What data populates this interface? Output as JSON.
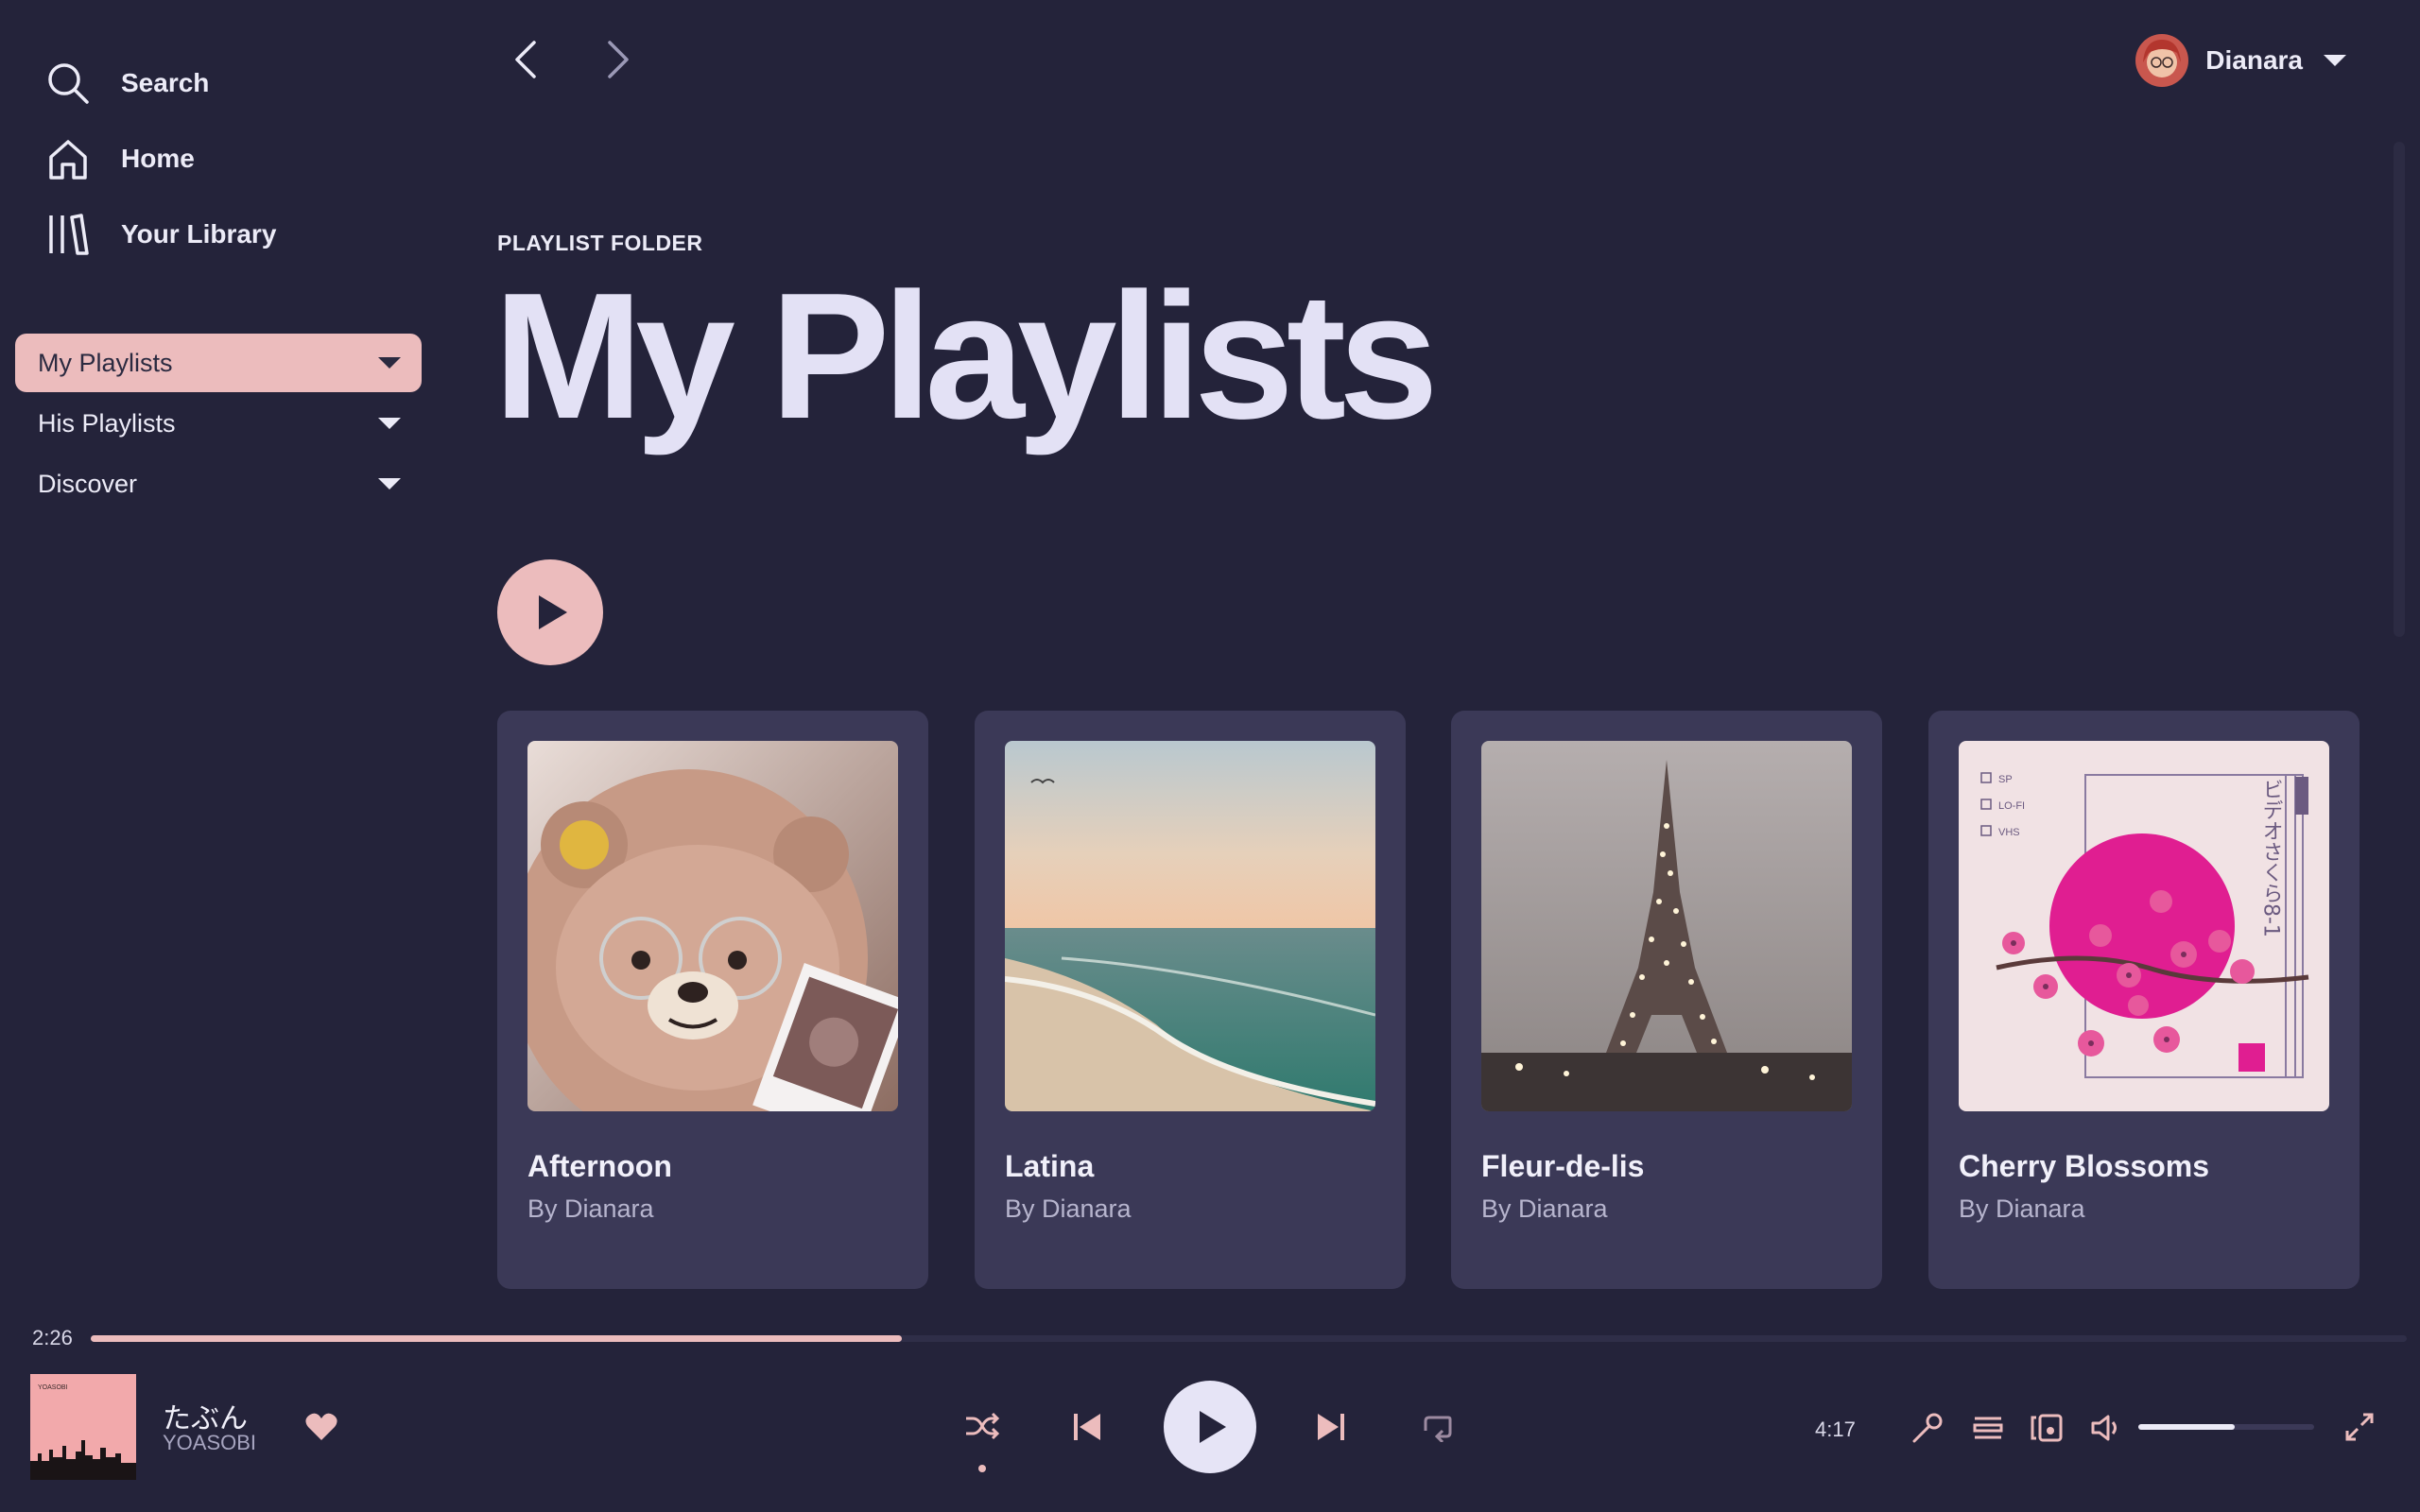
{
  "sidebar": {
    "nav": [
      {
        "label": "Search",
        "icon": "search-icon"
      },
      {
        "label": "Home",
        "icon": "home-icon"
      },
      {
        "label": "Your Library",
        "icon": "library-icon"
      }
    ],
    "folders": [
      {
        "label": "My Playlists",
        "active": true
      },
      {
        "label": "His Playlists",
        "active": false
      },
      {
        "label": "Discover",
        "active": false
      }
    ]
  },
  "topbar": {
    "user_name": "Dianara"
  },
  "header": {
    "eyebrow": "PLAYLIST FOLDER",
    "title": "My Playlists"
  },
  "cards": [
    {
      "title": "Afternoon",
      "subtitle": "By Dianara"
    },
    {
      "title": "Latina",
      "subtitle": "By Dianara"
    },
    {
      "title": "Fleur-de-lis",
      "subtitle": "By Dianara"
    },
    {
      "title": "Cherry Blossoms",
      "subtitle": "By Dianara"
    }
  ],
  "cherry_art_text": {
    "options": [
      "SP",
      "LO-FI",
      "VHS"
    ],
    "vertical": "ビデオさくら8-1"
  },
  "player": {
    "elapsed": "2:26",
    "duration": "4:17",
    "progress": 0.35,
    "volume": 0.55,
    "track_title": "たぶん",
    "track_artist": "YOASOBI",
    "album_art_text": "YOASOBI",
    "liked": true,
    "shuffle_on": true
  },
  "colors": {
    "background": "#24233a",
    "card": "#3b3957",
    "accent": "#ecbcbd",
    "text": "#ecebf7"
  }
}
